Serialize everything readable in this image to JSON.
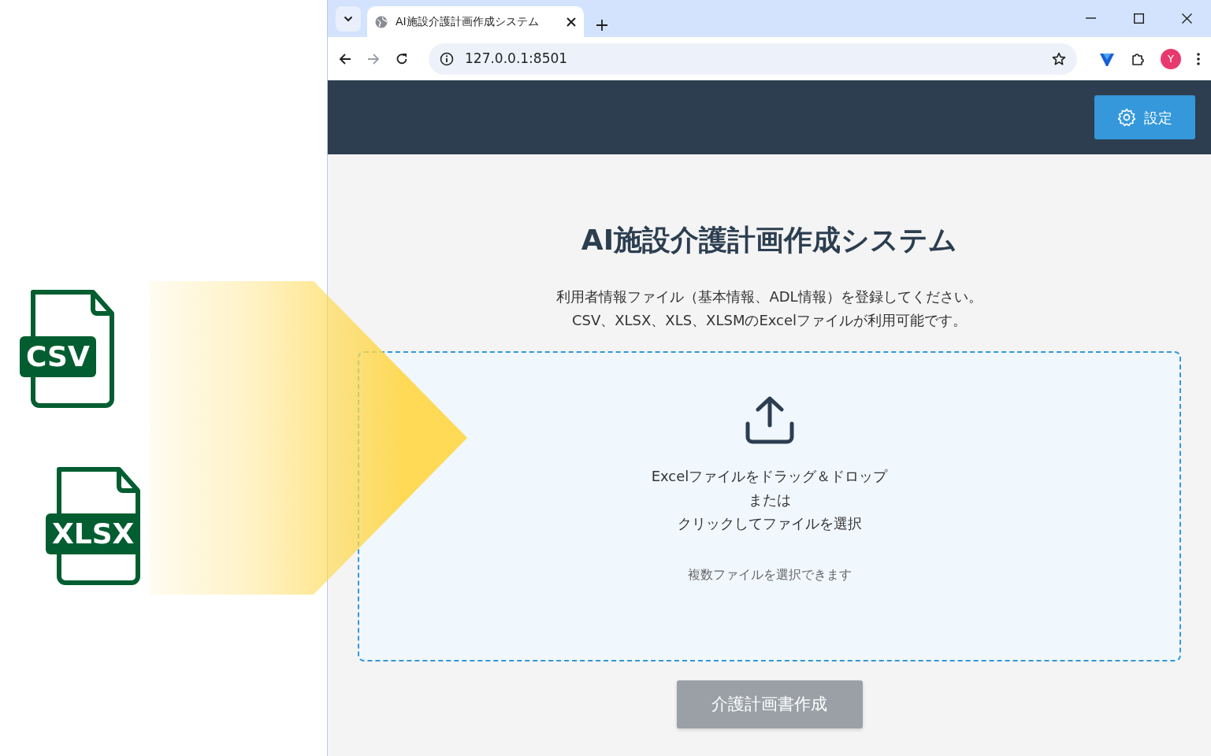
{
  "illustration": {
    "file_types": [
      "CSV",
      "XLSX"
    ]
  },
  "browser": {
    "tab_title": "AI施設介護計画作成システム",
    "url": "127.0.0.1:8501",
    "profile_initial": "Y"
  },
  "header": {
    "settings_button": "設定"
  },
  "title": "AI施設介護計画作成システム",
  "description": [
    "利用者情報ファイル（基本情報、ADL情報）を登録してください。",
    "CSV、XLSX、XLS、XLSMのExcelファイルが利用可能です。"
  ],
  "dropzone": {
    "lines": [
      "Excelファイルをドラッグ＆ドロップ",
      "または",
      "クリックしてファイルを選択"
    ],
    "note": "複数ファイルを選択できます"
  },
  "submit_button": {
    "label": "介護計画書作成",
    "disabled": true
  }
}
